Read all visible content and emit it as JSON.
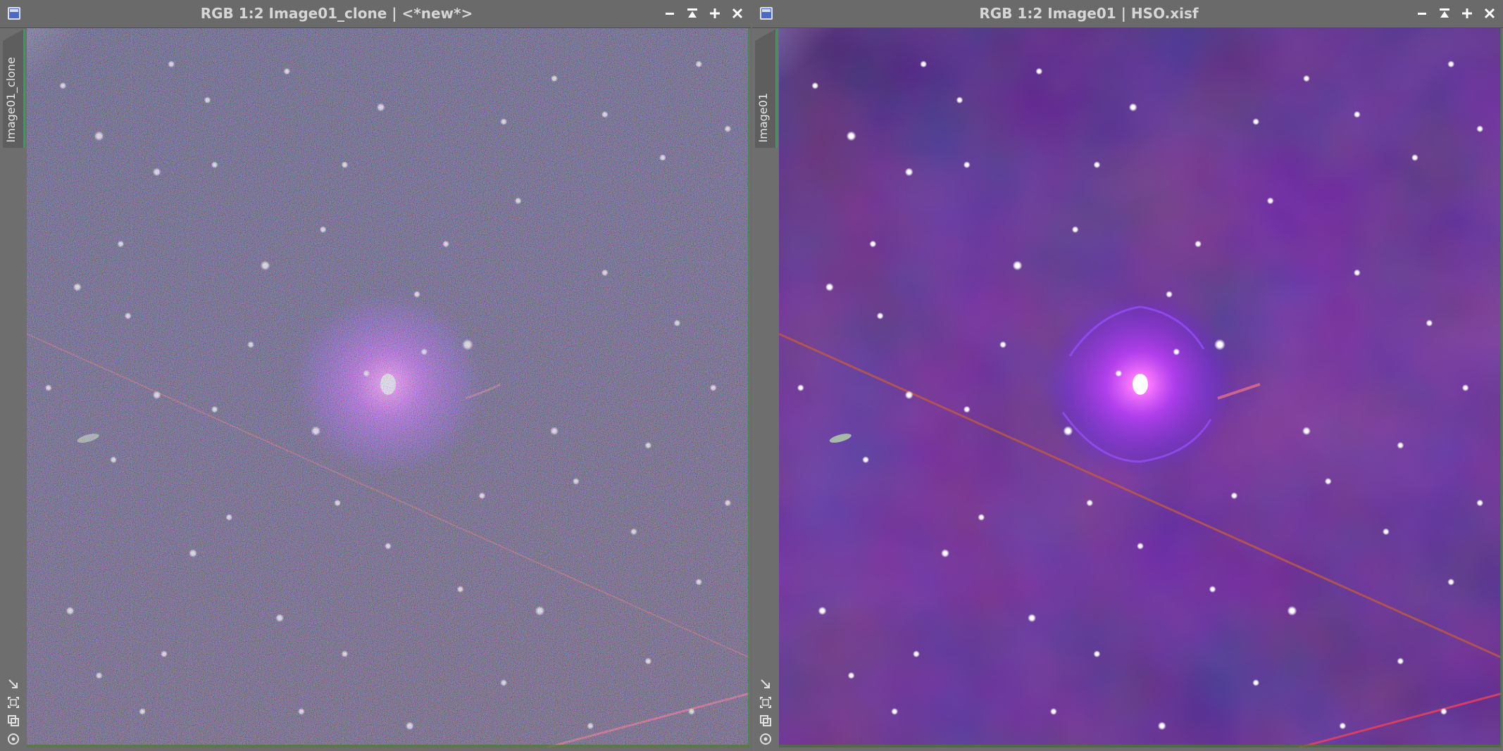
{
  "windows": [
    {
      "title": "RGB 1:2 Image01_clone | <*new*>",
      "tab_label": "Image01_clone",
      "view": "noisy"
    },
    {
      "title": "RGB 1:2 Image01 | HSO.xisf",
      "tab_label": "Image01",
      "view": "denoised"
    }
  ],
  "icons": {
    "system_menu": "window-menu-icon",
    "minimize": "minimize-icon",
    "shade": "shade-icon",
    "maximize": "maximize-icon",
    "close": "close-icon",
    "tools": [
      "resize-icon",
      "fit-view-icon",
      "clone-icon",
      "zoom-icon"
    ]
  },
  "colors": {
    "frame": "#6e6e6e",
    "title_text": "#d6d6d6",
    "tab_accent": "#2fa05a",
    "sky_top": "#1a2a5a",
    "nebula": "#c040ff"
  }
}
